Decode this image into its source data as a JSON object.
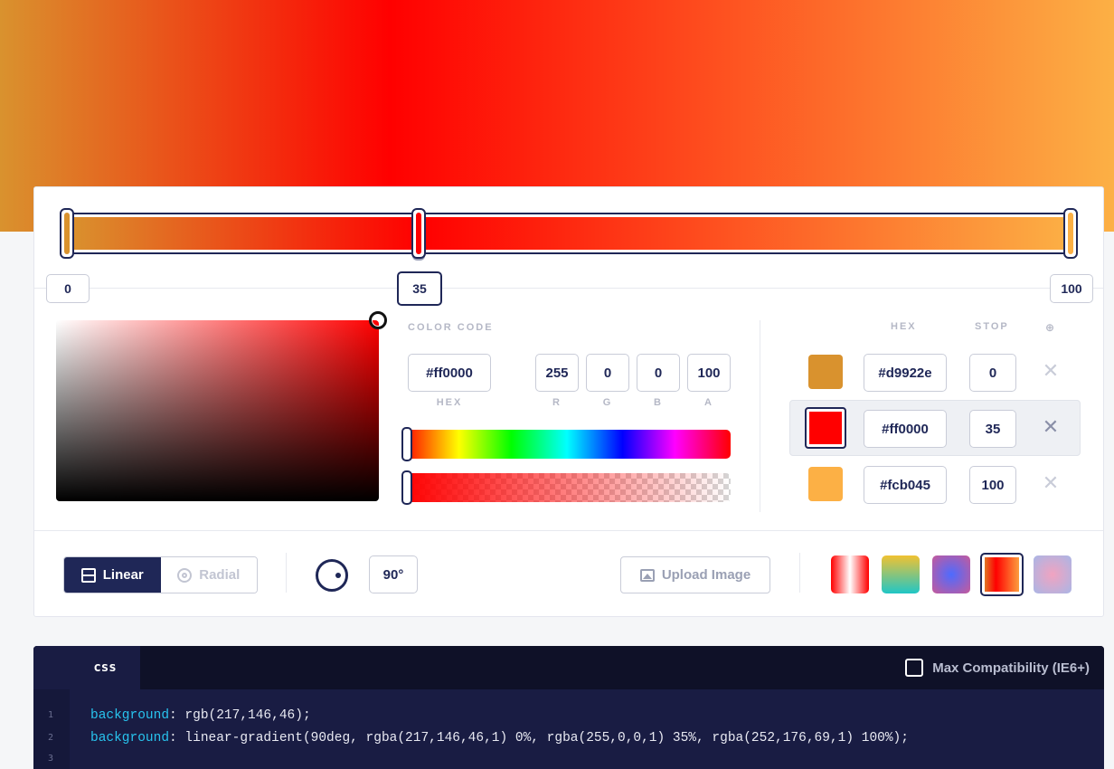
{
  "gradient": {
    "colors": {
      "stop1": "#d9922e",
      "stop2": "#ff0000",
      "stop3": "#fcb045",
      "accent": "#1f2757"
    },
    "stops": [
      {
        "label": "0",
        "hex": "#d9922e",
        "stop": "0",
        "active": false
      },
      {
        "label": "35",
        "hex": "#ff0000",
        "stop": "35",
        "active": true
      },
      {
        "label": "100",
        "hex": "#fcb045",
        "stop": "100",
        "active": false
      }
    ]
  },
  "picker": {
    "color_code_caption": "COLOR CODE",
    "hex_value": "#ff0000",
    "hex_label": "HEX",
    "r_value": "255",
    "r_label": "R",
    "g_value": "0",
    "g_label": "G",
    "b_value": "0",
    "b_label": "B",
    "a_value": "100",
    "a_label": "A"
  },
  "stops_table": {
    "header_hex": "HEX",
    "header_stop": "STOP",
    "header_icon": "⊕",
    "delete_icon": "✕"
  },
  "controls": {
    "linear_label": "Linear",
    "radial_label": "Radial",
    "type_selected": "Linear",
    "angle": "90°",
    "upload_label": "Upload Image",
    "presets": [
      {
        "name": "red-white-red",
        "active": false
      },
      {
        "name": "yellow-teal",
        "active": false
      },
      {
        "name": "purple-blue-radial",
        "active": false
      },
      {
        "name": "orange-red-yellow",
        "active": true
      },
      {
        "name": "pink-blue-radial",
        "active": false
      }
    ]
  },
  "code": {
    "tab": "css",
    "compat_label": "Max Compatibility (IE6+)",
    "compat_checked": false,
    "lines": [
      {
        "num": "1",
        "prop": "background",
        "value": ": rgb(217,146,46);"
      },
      {
        "num": "2",
        "prop": "background",
        "value": ": linear-gradient(90deg, rgba(217,146,46,1) 0%, rgba(255,0,0,1) 35%, rgba(252,176,69,1) 100%);"
      },
      {
        "num": "3",
        "prop": "",
        "value": ""
      }
    ]
  }
}
